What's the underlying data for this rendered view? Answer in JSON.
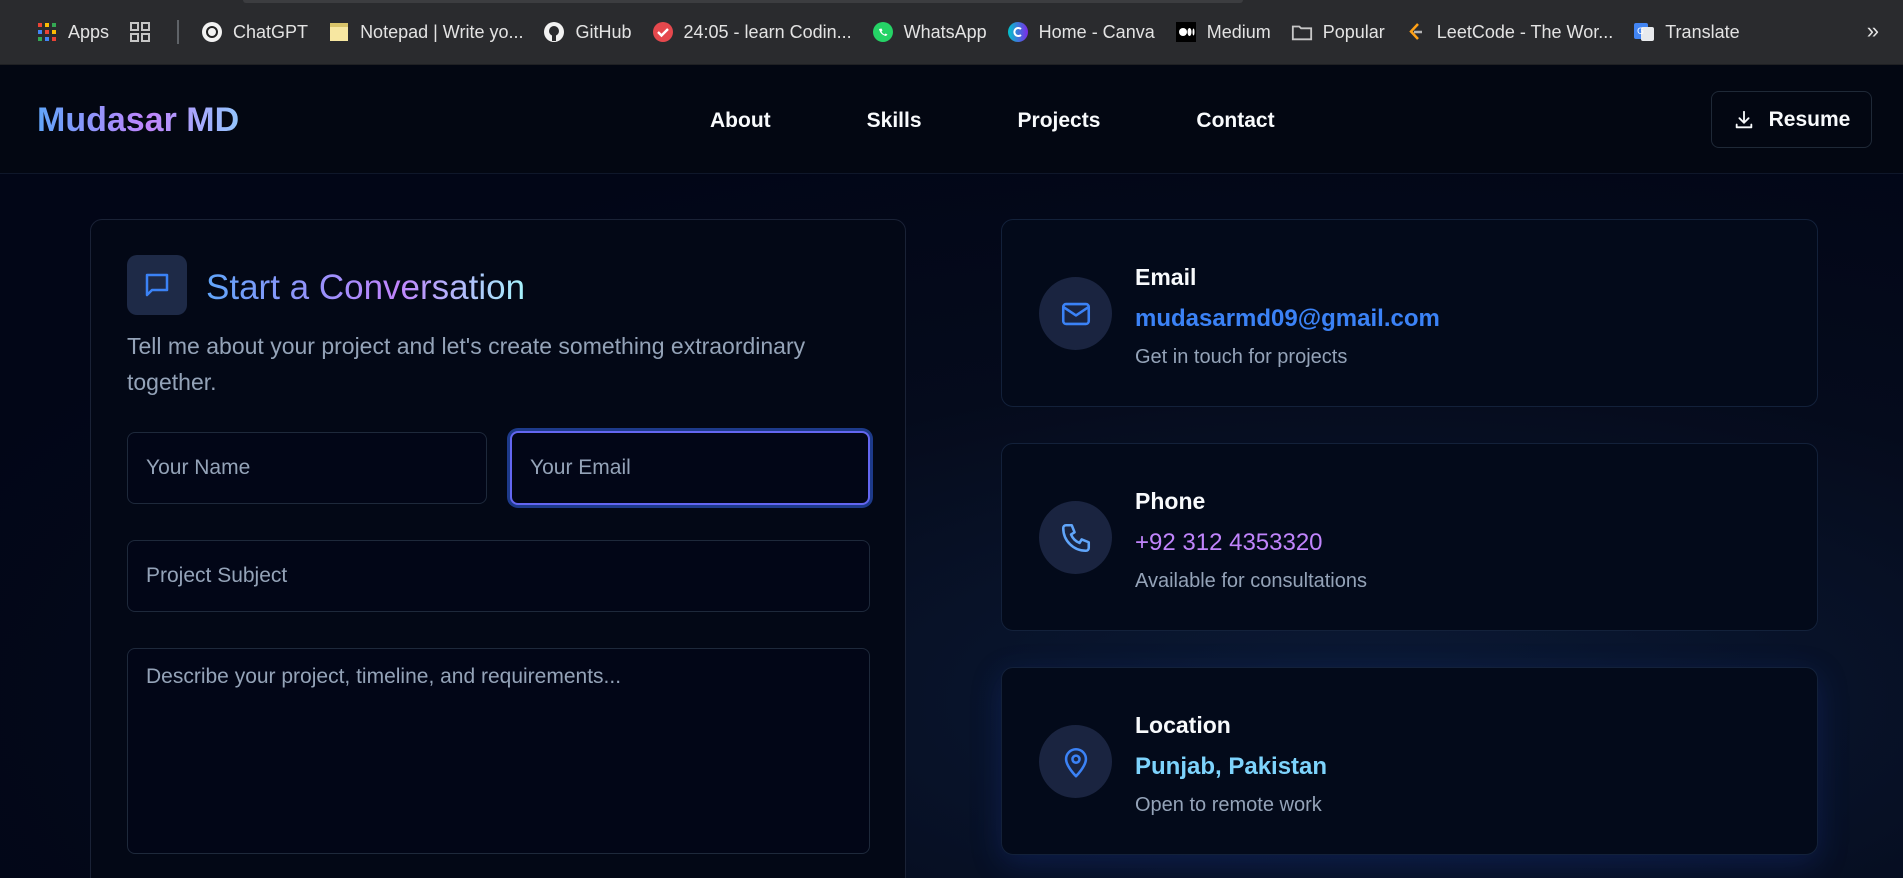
{
  "bookmarks": {
    "items": [
      {
        "label": "Apps",
        "icon": "apps-grid-icon"
      },
      {
        "label": "",
        "icon": "grid-icon"
      },
      {
        "label": "ChatGPT",
        "icon": "chatgpt-icon"
      },
      {
        "label": "Notepad | Write yo...",
        "icon": "notepad-icon"
      },
      {
        "label": "GitHub",
        "icon": "github-icon"
      },
      {
        "label": "24:05 - learn Codin...",
        "icon": "check-icon"
      },
      {
        "label": "WhatsApp",
        "icon": "whatsapp-icon"
      },
      {
        "label": "Home - Canva",
        "icon": "canva-icon"
      },
      {
        "label": "Medium",
        "icon": "medium-icon"
      },
      {
        "label": "Popular",
        "icon": "folder-icon"
      },
      {
        "label": "LeetCode - The Wor...",
        "icon": "leetcode-icon"
      },
      {
        "label": "Translate",
        "icon": "translate-icon"
      }
    ],
    "more": "»"
  },
  "nav": {
    "logo": "Mudasar MD",
    "links": [
      "About",
      "Skills",
      "Projects",
      "Contact"
    ],
    "resume": "Resume"
  },
  "form": {
    "title": "Start a Conversation",
    "subtitle": "Tell me about your project and let's create something extraordinary together.",
    "name_placeholder": "Your Name",
    "email_placeholder": "Your Email",
    "subject_placeholder": "Project Subject",
    "message_placeholder": "Describe your project, timeline, and requirements..."
  },
  "contact": [
    {
      "label": "Email",
      "value": "mudasarmd09@gmail.com",
      "note": "Get in touch for projects",
      "icon": "mail-icon",
      "color": "#3b82f6"
    },
    {
      "label": "Phone",
      "value": "+92 312 4353320",
      "note": "Available for consultations",
      "icon": "phone-icon",
      "color": "#c084fc"
    },
    {
      "label": "Location",
      "value": "Punjab, Pakistan",
      "note": "Open to remote work",
      "icon": "map-pin-icon",
      "color": "#7dd3fc"
    }
  ],
  "colors": {
    "background": "#020617",
    "accent_blue": "#3b82f6",
    "accent_purple": "#c084fc",
    "accent_cyan": "#7dd3fc",
    "focus_ring": "#6366f1"
  }
}
